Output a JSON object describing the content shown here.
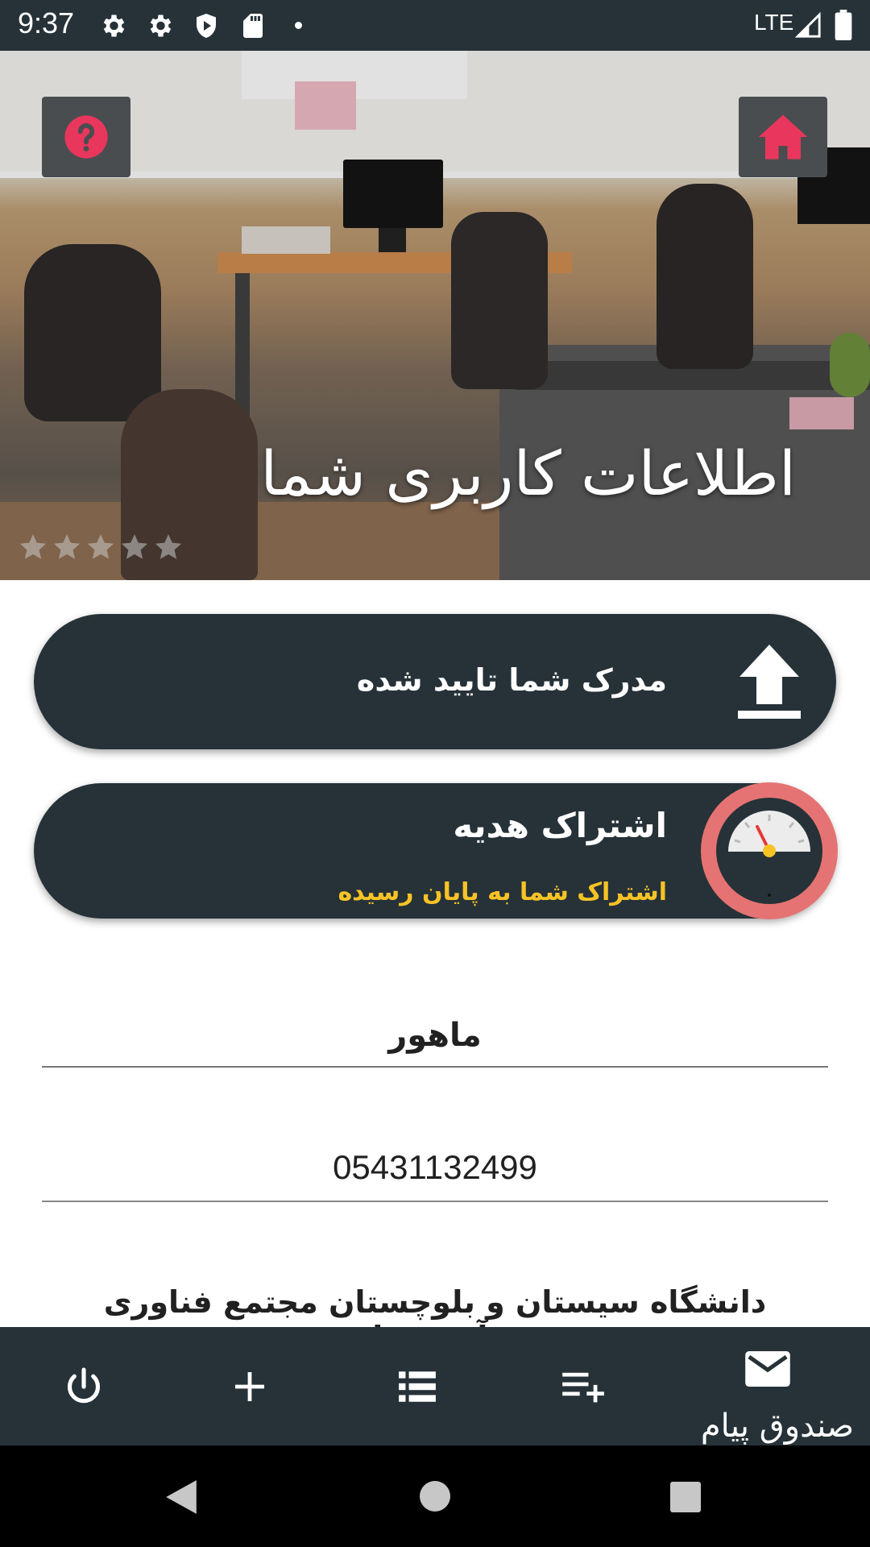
{
  "status_bar": {
    "time": "9:37",
    "network": "LTE",
    "icons": [
      "settings-icon",
      "settings-icon",
      "shield-icon",
      "sd-card-icon",
      "dot-icon",
      "signal-icon",
      "battery-icon"
    ]
  },
  "header": {
    "title": "اطلاعات کاربری شما",
    "help_icon": "help-icon",
    "home_icon": "home-icon",
    "rating": {
      "value": 0,
      "max": 5
    }
  },
  "document_card": {
    "label": "مدرک شما تایید شده",
    "icon": "upload-icon"
  },
  "subscription_card": {
    "title": "اشتراک هدیه",
    "status": "اشتراک شما به پایان رسیده",
    "icon": "gauge-icon",
    "status_color": "#f7c325"
  },
  "profile": {
    "name": "ماهور",
    "phone": "05431132499",
    "organization": "دانشگاه سیستان و بلوچستان مجتمع فناوری ونوآوری واحد"
  },
  "bottom_nav": {
    "items": [
      {
        "icon": "power-icon"
      },
      {
        "icon": "add-icon"
      },
      {
        "icon": "list-icon"
      },
      {
        "icon": "playlist-add-icon"
      },
      {
        "icon": "mail-icon",
        "label": "صندوق پیام"
      }
    ]
  },
  "colors": {
    "primary_dark": "#263238",
    "accent": "#e8365d",
    "warning": "#f7c325",
    "gauge_ring": "#e57373"
  }
}
